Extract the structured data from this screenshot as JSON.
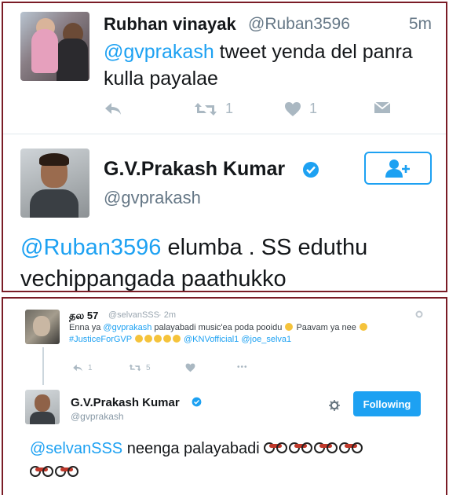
{
  "top_panel": {
    "tweet1": {
      "name": "Rubhan vinayak",
      "handle": "@Ruban3596",
      "time": "5m",
      "mention": "@gvprakash",
      "text": " tweet yenda del panra kulla payalae",
      "retweets": "1",
      "likes": "1"
    },
    "tweet2": {
      "name": "G.V.Prakash Kumar",
      "handle": "@gvprakash",
      "mention": "@Ruban3596",
      "text": " elumba . SS eduthu vechippangada paathukko"
    }
  },
  "bottom_panel": {
    "tweet1": {
      "name": "தல 57",
      "handle": "@selvanSSS",
      "time": "· 2m",
      "text_a": "Enna ya ",
      "mention1": "@gvprakash",
      "text_b": "  palayabadi music'ea poda pooidu ",
      "text_c": " Paavam ya nee ",
      "hashtag": "#JusticeForGVP",
      "mention2": "@KNVofficial1",
      "mention3": "@joe_selva1",
      "replies": "1",
      "retweets": "5",
      "more": "•••"
    },
    "tweet2": {
      "name": "G.V.Prakash Kumar",
      "handle": "@gvprakash",
      "following_label": "Following",
      "mention": "@selvanSSS",
      "text": " neenga palayabadi "
    }
  },
  "colors": {
    "link": "#1da1f2",
    "border": "#7a1c26",
    "muted": "#657786"
  }
}
